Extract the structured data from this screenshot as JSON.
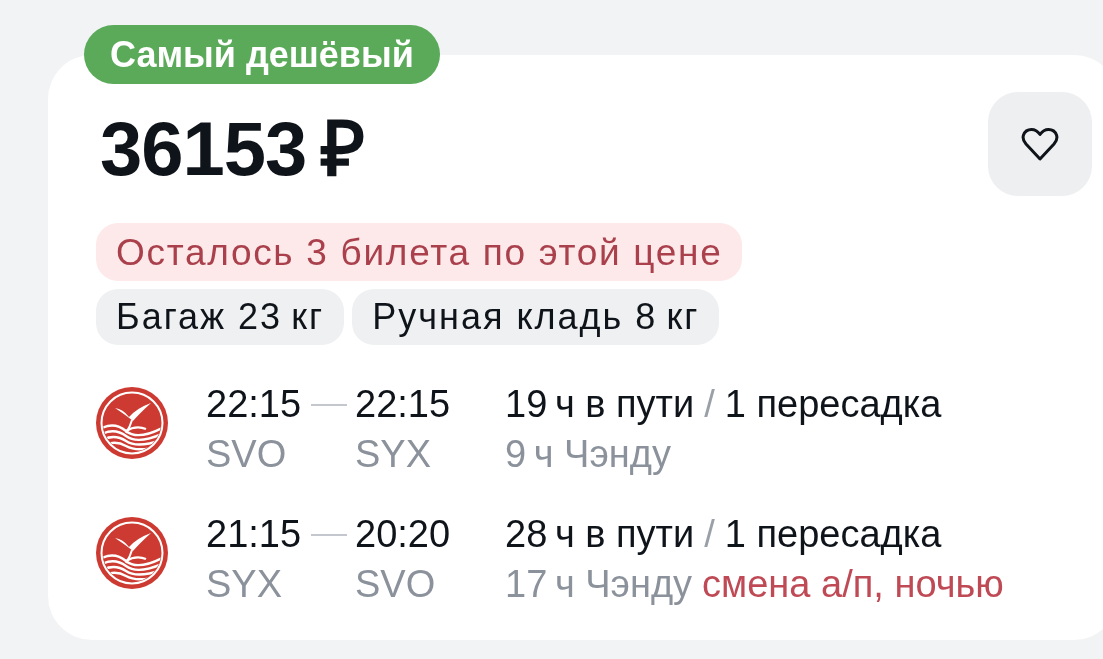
{
  "badge": {
    "label": "Самый дешёвый"
  },
  "offer": {
    "price": "36153 ₽",
    "favorite": {
      "selected": false
    }
  },
  "notice": "Осталось 3 билета по этой цене",
  "tags": [
    "Багаж 23 кг",
    "Ручная кладь 8 кг"
  ],
  "flights": [
    {
      "departure_time": "22:15",
      "arrival_time": "22:15",
      "departure_airport": "SVO",
      "arrival_airport": "SYX",
      "duration": "19 ч в пути",
      "separator": "/",
      "stops": "1 пересадка",
      "layover": "9 ч Чэнду"
    },
    {
      "departure_time": "21:15",
      "arrival_time": "20:20",
      "departure_airport": "SYX",
      "arrival_airport": "SVO",
      "duration": "28 ч в пути",
      "separator": "/",
      "stops": "1 пересадка",
      "layover": "17 ч Чэнду",
      "warning": "смена а/п, ночью"
    }
  ]
}
